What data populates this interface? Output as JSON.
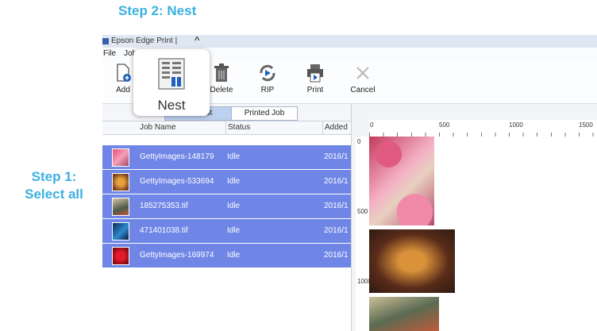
{
  "annotations": {
    "step2": "Step 2: Nest",
    "step1_line1": "Step 1:",
    "step1_line2": "Select all"
  },
  "app": {
    "title": "Epson Edge Print |",
    "menu": [
      "File",
      "Job"
    ],
    "toolbar": {
      "add": "Add",
      "delete": "Delete",
      "rip": "RIP",
      "print": "Print",
      "cancel": "Cancel"
    },
    "nest_popup_label": "Nest",
    "tabs": {
      "job_list": "Job List",
      "printed_job": "Printed Job"
    },
    "columns": {
      "job_name": "Job Name",
      "status": "Status",
      "added": "Added"
    },
    "jobs": [
      {
        "name": "GettyImages-148179",
        "status": "Idle",
        "date": "2016/1"
      },
      {
        "name": "GettyImages-533694",
        "status": "Idle",
        "date": "2016/1"
      },
      {
        "name": "185275353.tif",
        "status": "Idle",
        "date": "2016/1"
      },
      {
        "name": "471401038.tif",
        "status": "Idle",
        "date": "2016/1"
      },
      {
        "name": "GettyImages-169974",
        "status": "Idle",
        "date": "2016/1"
      }
    ],
    "ruler": {
      "h_labels": [
        "0",
        "500",
        "1000",
        "1500"
      ],
      "v_labels": [
        "0",
        "500",
        "1000"
      ]
    }
  },
  "colors": {
    "accent": "#3bb0e0",
    "row_selected": "#6f86e6"
  }
}
